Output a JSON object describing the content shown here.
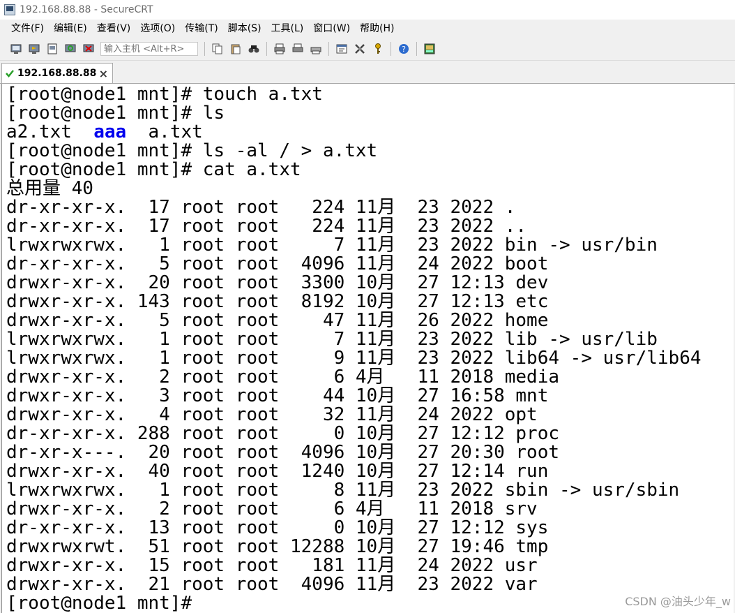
{
  "window": {
    "title": "192.168.88.88 - SecureCRT"
  },
  "menu": [
    "文件(F)",
    "编辑(E)",
    "查看(V)",
    "选项(O)",
    "传输(T)",
    "脚本(S)",
    "工具(L)",
    "窗口(W)",
    "帮助(H)"
  ],
  "toolbar": {
    "quick_connect_placeholder": "输入主机 <Alt+R>"
  },
  "tab": {
    "label": "192.168.88.88",
    "close": "×"
  },
  "terminal": {
    "lines": [
      "[root@node1 mnt]# touch a.txt",
      "[root@node1 mnt]# ls",
      "LS_OUTPUT",
      "[root@node1 mnt]# ls -al / > a.txt",
      "[root@node1 mnt]# cat a.txt",
      "总用量 40",
      "dr-xr-xr-x.  17 root root   224 11月  23 2022 .",
      "dr-xr-xr-x.  17 root root   224 11月  23 2022 ..",
      "lrwxrwxrwx.   1 root root     7 11月  23 2022 bin -> usr/bin",
      "dr-xr-xr-x.   5 root root  4096 11月  24 2022 boot",
      "drwxr-xr-x.  20 root root  3300 10月  27 12:13 dev",
      "drwxr-xr-x. 143 root root  8192 10月  27 12:13 etc",
      "drwxr-xr-x.   5 root root    47 11月  26 2022 home",
      "lrwxrwxrwx.   1 root root     7 11月  23 2022 lib -> usr/lib",
      "lrwxrwxrwx.   1 root root     9 11月  23 2022 lib64 -> usr/lib64",
      "drwxr-xr-x.   2 root root     6 4月   11 2018 media",
      "drwxr-xr-x.   3 root root    44 10月  27 16:58 mnt",
      "drwxr-xr-x.   4 root root    32 11月  24 2022 opt",
      "dr-xr-xr-x. 288 root root     0 10月  27 12:12 proc",
      "dr-xr-x---.  20 root root  4096 10月  27 20:30 root",
      "drwxr-xr-x.  40 root root  1240 10月  27 12:14 run",
      "lrwxrwxrwx.   1 root root     8 11月  23 2022 sbin -> usr/sbin",
      "drwxr-xr-x.   2 root root     6 4月   11 2018 srv",
      "dr-xr-xr-x.  13 root root     0 10月  27 12:12 sys",
      "drwxrwxrwt.  51 root root 12288 10月  27 19:46 tmp",
      "drwxr-xr-x.  15 root root   181 11月  24 2022 usr",
      "drwxr-xr-x.  21 root root  4096 11月  23 2022 var",
      "[root@node1 mnt]# "
    ],
    "ls_output": {
      "file1": "a2.txt",
      "dir": "aaa",
      "file2": "a.txt"
    }
  },
  "watermark": "CSDN @油头少年_w",
  "colors": {
    "directory": "#0000ee",
    "terminal_bg": "#ffffff",
    "terminal_fg": "#000000"
  }
}
